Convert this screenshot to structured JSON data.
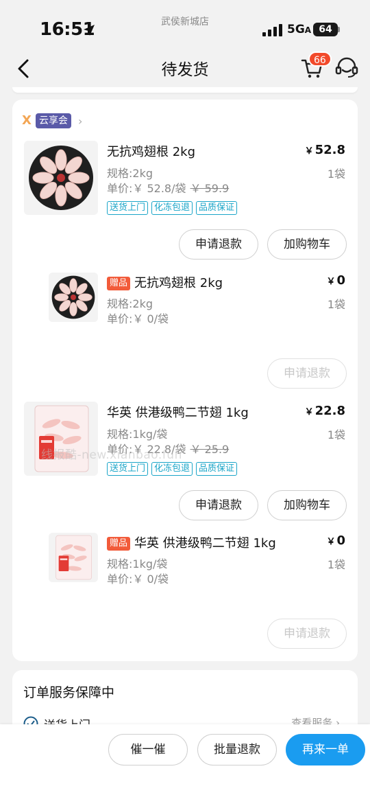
{
  "status_bar": {
    "time": "16:51",
    "store": "武侯新城店",
    "network": "5G",
    "battery": "64"
  },
  "nav": {
    "title": "待发货",
    "cart_count": "66"
  },
  "brand": {
    "name": "云享会"
  },
  "items": [
    {
      "name": "无抗鸡翅根 2kg",
      "price": "52.8",
      "qty": "1袋",
      "spec": "规格:2kg",
      "unit_price": "单价:￥ 52.8/袋",
      "orig_price": "￥ 59.9",
      "tags": [
        "送货上门",
        "化冻包退",
        "品质保证"
      ],
      "refund": "申请退款",
      "add_cart": "加购物车"
    },
    {
      "gift_label": "赠品",
      "name": "无抗鸡翅根 2kg",
      "price": "0",
      "qty": "1袋",
      "spec": "规格:2kg",
      "unit_price": "单价:￥ 0/袋",
      "refund": "申请退款"
    },
    {
      "name": "华英 供港级鸭二节翅 1kg",
      "price": "22.8",
      "qty": "1袋",
      "spec": "规格:1kg/袋",
      "unit_price": "单价:￥ 22.8/袋",
      "orig_price": "￥ 25.9",
      "tags": [
        "送货上门",
        "化冻包退",
        "品质保证"
      ],
      "refund": "申请退款",
      "add_cart": "加购物车"
    },
    {
      "gift_label": "赠品",
      "name": "华英 供港级鸭二节翅 1kg",
      "price": "0",
      "qty": "1袋",
      "spec": "规格:1kg/袋",
      "unit_price": "单价:￥ 0/袋",
      "refund": "申请退款"
    }
  ],
  "currency": "￥",
  "watermark": "线报酷-new.xianbao.fun",
  "service_card": {
    "title": "订单服务保障中",
    "row_label": "送货上门",
    "row_link": "查看服务"
  },
  "bottom": {
    "urge": "催一催",
    "batch_refund": "批量退款",
    "reorder": "再来一单"
  },
  "colors": {
    "accent": "#1a9cf0",
    "badge": "#f24a2b",
    "tag": "#1aa5c8",
    "gift": "#f25b3a"
  }
}
